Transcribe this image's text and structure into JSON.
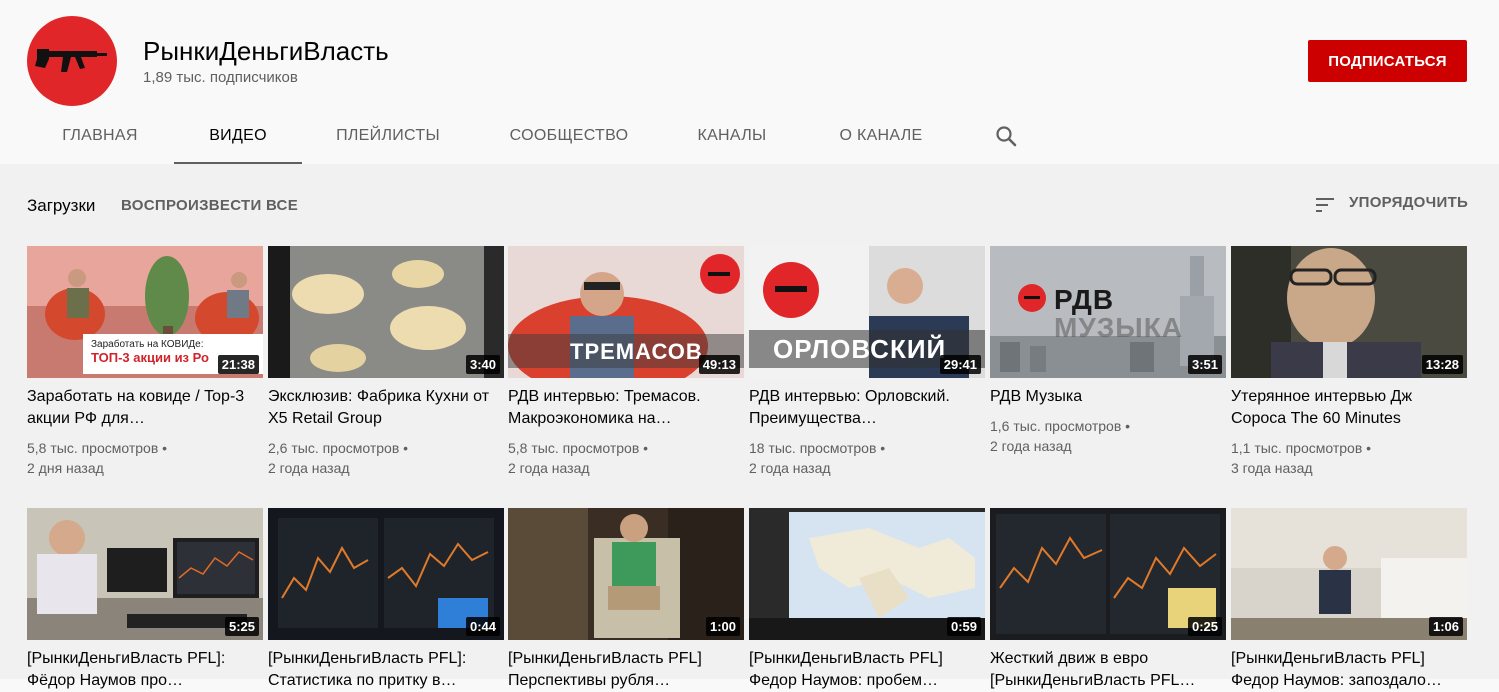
{
  "channel": {
    "name": "РынкиДеньгиВласть",
    "subscribers": "1,89 тыс. подписчиков",
    "subscribe_label": "ПОДПИСАТЬСЯ",
    "avatar_color": "#e1262a"
  },
  "tabs": [
    {
      "label": "ГЛАВНАЯ",
      "active": false
    },
    {
      "label": "ВИДЕО",
      "active": true
    },
    {
      "label": "ПЛЕЙЛИСТЫ",
      "active": false
    },
    {
      "label": "СООБЩЕСТВО",
      "active": false
    },
    {
      "label": "КАНАЛЫ",
      "active": false
    },
    {
      "label": "О КАНАЛЕ",
      "active": false
    }
  ],
  "search_icon": "search-icon",
  "section": {
    "title": "Загрузки",
    "play_all": "ВОСПРОИЗВЕСТИ ВСЕ",
    "sort_label": "УПОРЯДОЧИТЬ"
  },
  "videos": [
    {
      "title": "Заработать на ковиде / Top-3 акции РФ для…",
      "views": "5,8 тыс. просмотров",
      "age": "2 дня назад",
      "duration": "21:38",
      "overlay": {
        "caption": "Заработать на КОВИДе:",
        "headline": "ТОП-3 акции из Ро"
      }
    },
    {
      "title": "Эксклюзив: Фабрика Кухни от X5 Retail Group",
      "views": "2,6 тыс. просмотров",
      "age": "2 года назад",
      "duration": "3:40"
    },
    {
      "title": "РДВ интервью: Тремасов. Макроэкономика на…",
      "views": "5,8 тыс. просмотров",
      "age": "2 года назад",
      "duration": "49:13",
      "overlay": {
        "headline": "ТРЕМАСОВ"
      }
    },
    {
      "title": "РДВ интервью: Орловский. Преимущества…",
      "views": "18 тыс. просмотров",
      "age": "2 года назад",
      "duration": "29:41",
      "overlay": {
        "headline": "ОРЛОВСКИЙ"
      }
    },
    {
      "title": "РДВ Музыка",
      "views": "1,6 тыс. просмотров",
      "age": "2 года назад",
      "duration": "3:51",
      "overlay": {
        "headline": "РДВ",
        "caption": "МУЗЫКА"
      }
    },
    {
      "title": "Утерянное интервью Дж Сороса The 60 Minutes",
      "views": "1,1 тыс. просмотров",
      "age": "3 года назад",
      "duration": "13:28"
    },
    {
      "title": "[РынкиДеньгиВласть PFL]: Фёдор Наумов про…",
      "duration": "5:25"
    },
    {
      "title": "[РынкиДеньгиВласть PFL]: Статистика по притку в…",
      "duration": "0:44"
    },
    {
      "title": "[РынкиДеньгиВласть PFL] Перспективы рубля…",
      "duration": "1:00"
    },
    {
      "title": "[РынкиДеньгиВласть PFL] Федор Наумов: пробем…",
      "duration": "0:59"
    },
    {
      "title": "Жесткий движ в евро [РынкиДеньгиВласть PFL…",
      "duration": "0:25"
    },
    {
      "title": "[РынкиДеньгиВласть PFL] Федор Наумов: запоздало…",
      "duration": "1:06"
    }
  ]
}
